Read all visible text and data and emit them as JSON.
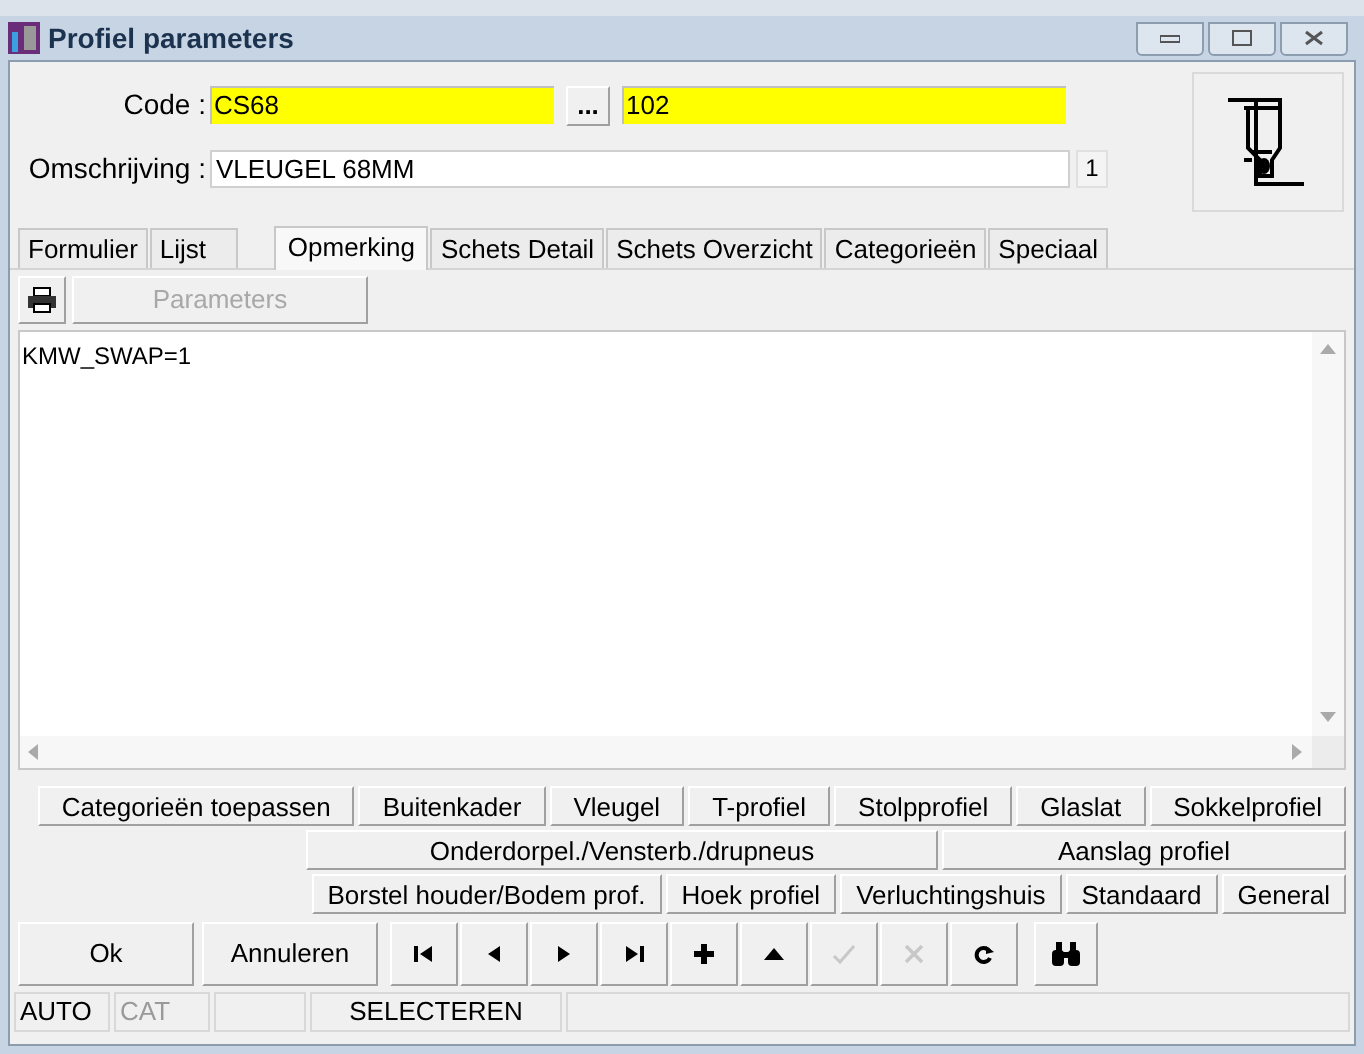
{
  "window": {
    "title": "Profiel parameters"
  },
  "code": {
    "label": "Code :",
    "value": "CS68",
    "browse": "...",
    "value_2": "102"
  },
  "description": {
    "label": "Omschrijving :",
    "value": "VLEUGEL 68MM",
    "count": "1"
  },
  "tabs": [
    {
      "label": "Formulier",
      "selected": false
    },
    {
      "label": "Lijst",
      "selected": false
    },
    {
      "label": "Opmerking",
      "selected": true
    },
    {
      "label": "Schets Detail",
      "selected": false
    },
    {
      "label": "Schets Overzicht",
      "selected": false
    },
    {
      "label": "Categorieën",
      "selected": false
    },
    {
      "label": "Speciaal",
      "selected": false
    }
  ],
  "toolbar": {
    "parameters": {
      "label": "Parameters",
      "disabled": true
    }
  },
  "remarks": {
    "value": "KMW_SWAP=1"
  },
  "category_rows": [
    [
      {
        "label": "Categorieën toepassen"
      },
      {
        "label": "Buitenkader"
      },
      {
        "label": "Vleugel"
      },
      {
        "label": "T-profiel"
      },
      {
        "label": "Stolpprofiel"
      },
      {
        "label": "Glaslat"
      },
      {
        "label": "Sokkelprofiel"
      }
    ],
    [
      {
        "label": "Onderdorpel./Vensterb./drupneus"
      },
      {
        "label": "Aanslag profiel"
      }
    ],
    [
      {
        "label": "Borstel houder/Bodem prof."
      },
      {
        "label": "Hoek profiel"
      },
      {
        "label": "Verluchtingshuis"
      },
      {
        "label": "Standaard"
      },
      {
        "label": "General"
      }
    ]
  ],
  "actions": [
    {
      "label": "Ok"
    },
    {
      "label": "Annuleren"
    }
  ],
  "nav_buttons": [
    {
      "kind": "first",
      "disabled": false
    },
    {
      "kind": "prev",
      "disabled": false
    },
    {
      "kind": "next",
      "disabled": false
    },
    {
      "kind": "last",
      "disabled": false
    },
    {
      "kind": "add",
      "disabled": false
    },
    {
      "kind": "up",
      "disabled": false
    },
    {
      "kind": "confirm",
      "disabled": true
    },
    {
      "kind": "cancel",
      "disabled": true
    },
    {
      "kind": "refresh",
      "disabled": false
    }
  ],
  "search_button": {
    "kind": "binoculars"
  },
  "status_bar": [
    {
      "text": "AUTO",
      "disabled": false
    },
    {
      "text": "CAT",
      "disabled": true
    },
    {
      "text": "SELECTEREN",
      "disabled": false
    }
  ]
}
